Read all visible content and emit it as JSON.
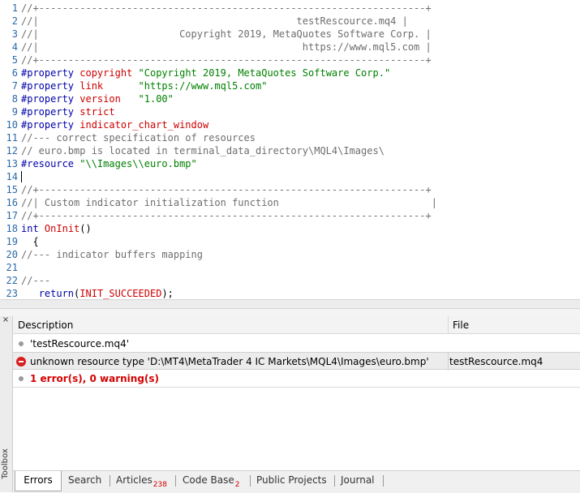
{
  "editor": {
    "lines": [
      {
        "num": "1",
        "tokens": [
          {
            "t": "comment",
            "v": "//+------------------------------------------------------------------+"
          }
        ]
      },
      {
        "num": "2",
        "tokens": [
          {
            "t": "comment",
            "v": "//|                                            testRescource.mq4 |"
          }
        ]
      },
      {
        "num": "3",
        "tokens": [
          {
            "t": "comment",
            "v": "//|                        Copyright 2019, MetaQuotes Software Corp. |"
          }
        ]
      },
      {
        "num": "4",
        "tokens": [
          {
            "t": "comment",
            "v": "//|                                             https://www.mql5.com |"
          }
        ]
      },
      {
        "num": "5",
        "tokens": [
          {
            "t": "comment",
            "v": "//+------------------------------------------------------------------+"
          }
        ]
      },
      {
        "num": "6",
        "tokens": [
          {
            "t": "pre",
            "v": "#property "
          },
          {
            "t": "prop",
            "v": "copyright"
          },
          {
            "t": "plain",
            "v": " "
          },
          {
            "t": "str",
            "v": "\"Copyright 2019, MetaQuotes Software Corp.\""
          }
        ]
      },
      {
        "num": "7",
        "tokens": [
          {
            "t": "pre",
            "v": "#property "
          },
          {
            "t": "prop",
            "v": "link"
          },
          {
            "t": "plain",
            "v": "      "
          },
          {
            "t": "str",
            "v": "\"https://www.mql5.com\""
          }
        ]
      },
      {
        "num": "8",
        "tokens": [
          {
            "t": "pre",
            "v": "#property "
          },
          {
            "t": "prop",
            "v": "version"
          },
          {
            "t": "plain",
            "v": "   "
          },
          {
            "t": "str",
            "v": "\"1.00\""
          }
        ]
      },
      {
        "num": "9",
        "tokens": [
          {
            "t": "pre",
            "v": "#property "
          },
          {
            "t": "prop",
            "v": "strict"
          }
        ]
      },
      {
        "num": "10",
        "tokens": [
          {
            "t": "pre",
            "v": "#property "
          },
          {
            "t": "prop",
            "v": "indicator_chart_window"
          }
        ]
      },
      {
        "num": "11",
        "tokens": [
          {
            "t": "comment",
            "v": "//--- correct specification of resources"
          }
        ]
      },
      {
        "num": "12",
        "tokens": [
          {
            "t": "comment",
            "v": "// euro.bmp is located in terminal_data_directory\\MQL4\\Images\\"
          }
        ]
      },
      {
        "num": "13",
        "tokens": [
          {
            "t": "pre",
            "v": "#resource "
          },
          {
            "t": "str",
            "v": "\"\\\\Images\\\\euro.bmp\""
          }
        ]
      },
      {
        "num": "14",
        "tokens": []
      },
      {
        "num": "15",
        "tokens": [
          {
            "t": "comment",
            "v": "//+------------------------------------------------------------------+"
          }
        ]
      },
      {
        "num": "16",
        "tokens": [
          {
            "t": "comment",
            "v": "//| Custom indicator initialization function                          |"
          }
        ]
      },
      {
        "num": "17",
        "tokens": [
          {
            "t": "comment",
            "v": "//+------------------------------------------------------------------+"
          }
        ]
      },
      {
        "num": "18",
        "tokens": [
          {
            "t": "kw",
            "v": "int"
          },
          {
            "t": "plain",
            "v": " "
          },
          {
            "t": "func",
            "v": "OnInit"
          },
          {
            "t": "punct",
            "v": "()"
          }
        ]
      },
      {
        "num": "19",
        "tokens": [
          {
            "t": "punct",
            "v": "  {"
          }
        ]
      },
      {
        "num": "20",
        "tokens": [
          {
            "t": "comment",
            "v": "//--- indicator buffers mapping"
          }
        ]
      },
      {
        "num": "21",
        "tokens": []
      },
      {
        "num": "22",
        "tokens": [
          {
            "t": "comment",
            "v": "//---"
          }
        ]
      },
      {
        "num": "23",
        "tokens": [
          {
            "t": "plain",
            "v": "   "
          },
          {
            "t": "kw",
            "v": "return"
          },
          {
            "t": "punct",
            "v": "("
          },
          {
            "t": "const",
            "v": "INIT_SUCCEEDED"
          },
          {
            "t": "punct",
            "v": ");"
          }
        ]
      }
    ],
    "caret_line": "14"
  },
  "toolbox": {
    "label": "Toolbox",
    "close_glyph": "×",
    "headers": {
      "description": "Description",
      "file": "File"
    },
    "rows": [
      {
        "kind": "info",
        "description": "'testRescource.mq4'",
        "file": ""
      },
      {
        "kind": "error",
        "description": "unknown resource type 'D:\\MT4\\MetaTrader 4 IC Markets\\MQL4\\Images\\euro.bmp'",
        "file": "testRescource.mq4"
      },
      {
        "kind": "summary",
        "description": "1 error(s), 0 warning(s)",
        "file": ""
      }
    ],
    "tabs": [
      {
        "label": "Errors",
        "badge": ""
      },
      {
        "label": "Search",
        "badge": ""
      },
      {
        "label": "Articles",
        "badge": "238"
      },
      {
        "label": "Code Base",
        "badge": "2"
      },
      {
        "label": "Public Projects",
        "badge": ""
      },
      {
        "label": "Journal",
        "badge": ""
      }
    ],
    "active_tab": "Errors"
  }
}
